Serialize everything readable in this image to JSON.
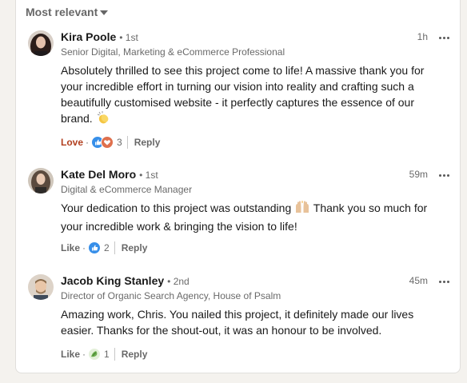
{
  "sort": {
    "label": "Most relevant"
  },
  "comments": [
    {
      "name": "Kira Poole",
      "degree": "• 1st",
      "headline": "Senior Digital, Marketing & eCommerce Professional",
      "time": "1h",
      "text": "Absolutely thrilled to see this project come to life! A massive thank you for your incredible effort in turning our vision into reality and crafting such a beautifully customised website - it perfectly captures the essence of our brand.",
      "reaction_label": "Love",
      "reaction_count": "3",
      "reply_label": "Reply",
      "avatar_color": "#3a2a26"
    },
    {
      "name": "Kate Del Moro",
      "degree": "• 1st",
      "headline": "Digital & eCommerce Manager",
      "time": "59m",
      "text_a": "Your dedication to this project was outstanding",
      "text_b": "Thank you so much for your incredible work & bringing the vision to life!",
      "reaction_label": "Like",
      "reaction_count": "2",
      "reply_label": "Reply",
      "avatar_color": "#6b5a4e"
    },
    {
      "name": "Jacob King Stanley",
      "degree": "• 2nd",
      "headline": "Director of Organic Search Agency, House of Psalm",
      "time": "45m",
      "text": "Amazing work, Chris. You nailed this project, it definitely made our lives easier. Thanks for the shout-out, it was an honour to be involved.",
      "reaction_label": "Like",
      "reaction_count": "1",
      "reply_label": "Reply",
      "avatar_color": "#c9b8a6"
    }
  ],
  "icons": {
    "more": "ellipsis-icon",
    "like": "like-reaction-icon",
    "love": "love-reaction-icon",
    "clap": "clapping-hands-emoji",
    "raise": "raising-hands-emoji",
    "support": "support-reaction-icon"
  },
  "colors": {
    "love": "#b24020",
    "like": "#378fe9",
    "heart": "#df704d",
    "support": "#6dae4f"
  }
}
